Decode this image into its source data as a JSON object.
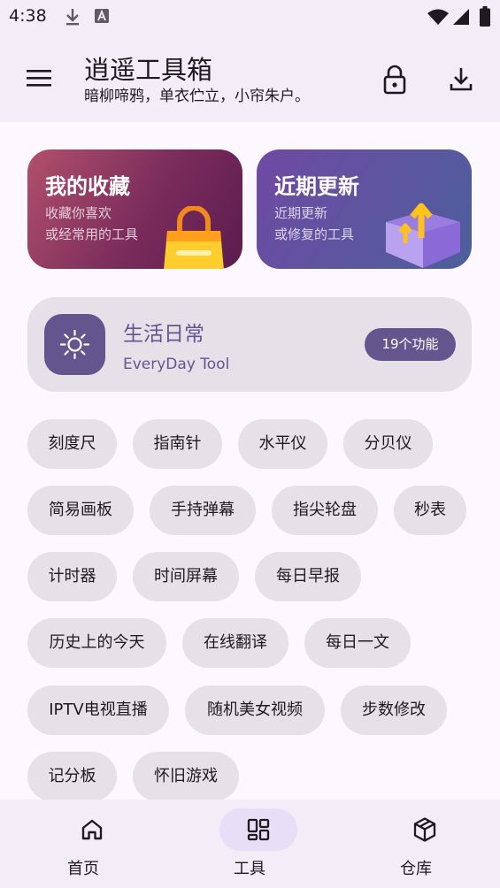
{
  "status_bar": {
    "time": "4:38",
    "icons": [
      "download-icon",
      "accessibility-a-icon",
      "wifi-icon",
      "signal-icon",
      "battery-icon"
    ]
  },
  "app_bar": {
    "title": "逍遥工具箱",
    "subtitle": "暗柳啼鸦，单衣伫立，小帘朱户。",
    "icons": [
      "menu-icon",
      "lock-icon",
      "download-icon"
    ]
  },
  "cards": {
    "favorites": {
      "title": "我的收藏",
      "line1": "收藏你喜欢",
      "line2": "或经常用的工具",
      "art": "shopping-bag-icon"
    },
    "recent": {
      "title": "近期更新",
      "line1": "近期更新",
      "line2": "或修复的工具",
      "art": "box-with-arrows-icon"
    }
  },
  "category": {
    "title": "生活日常",
    "subtitle": "EveryDay Tool",
    "badge": "19个功能",
    "icon": "sun-icon"
  },
  "tools": [
    "刻度尺",
    "指南针",
    "水平仪",
    "分贝仪",
    "简易画板",
    "手持弹幕",
    "指尖轮盘",
    "秒表",
    "计时器",
    "时间屏幕",
    "每日早报",
    "历史上的今天",
    "在线翻译",
    "每日一文",
    "IPTV电视直播",
    "随机美女视频",
    "步数修改",
    "记分板",
    "怀旧游戏"
  ],
  "bottom_nav": {
    "active": "tools",
    "items": [
      {
        "id": "home",
        "label": "首页",
        "icon": "home-icon"
      },
      {
        "id": "tools",
        "label": "工具",
        "icon": "grid-icon"
      },
      {
        "id": "warehouse",
        "label": "仓库",
        "icon": "cube-icon"
      }
    ]
  },
  "colors": {
    "background": "#fdf7ff",
    "surface": "#f3edf7",
    "chip": "#e6e0e9",
    "primary": "#65558f",
    "nav_active": "#e8def8"
  }
}
